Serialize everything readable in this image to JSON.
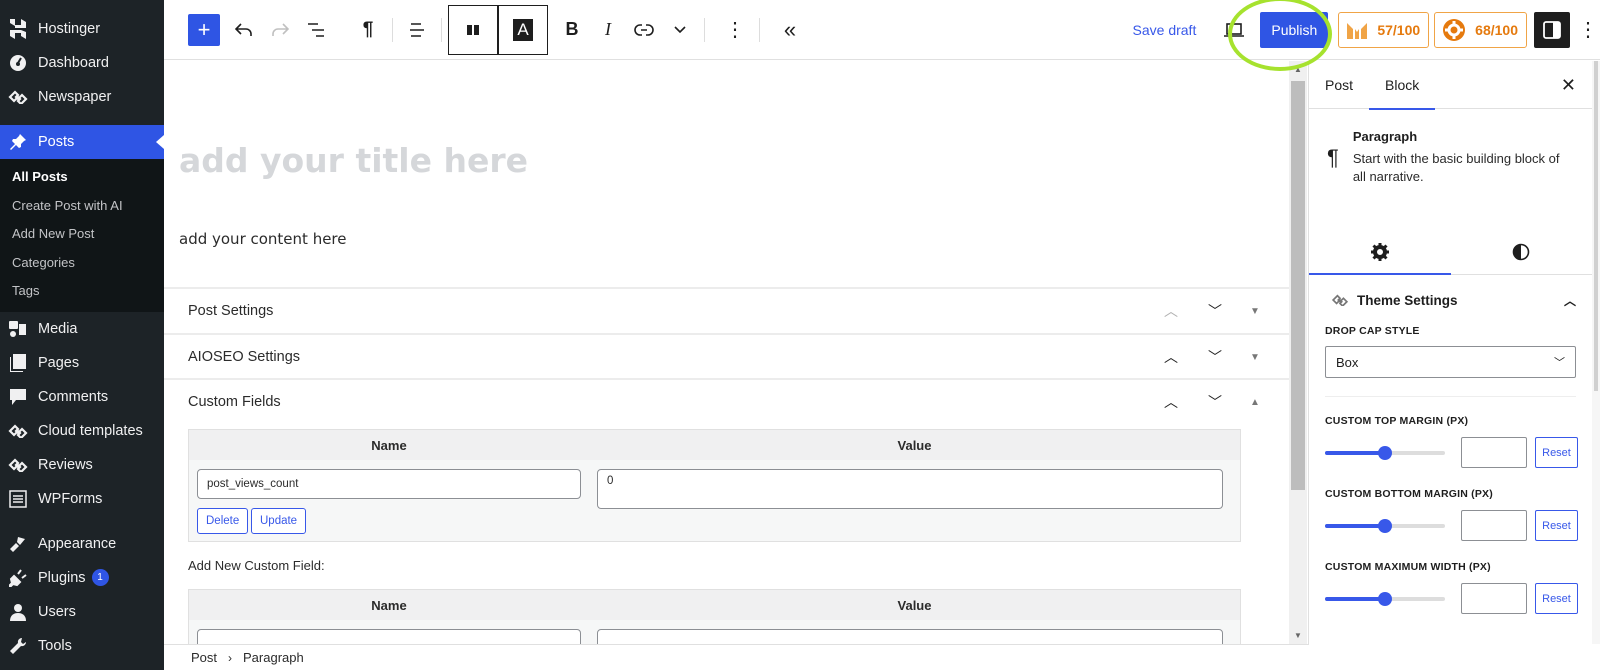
{
  "sidebar": {
    "top_items": [
      {
        "label": "Hostinger",
        "icon": "hostinger-logo-icon"
      },
      {
        "label": "Dashboard",
        "icon": "dashboard-icon"
      },
      {
        "label": "Newspaper",
        "icon": "newspaper-icon"
      }
    ],
    "active_item": {
      "label": "Posts",
      "icon": "pin-icon"
    },
    "submenu": [
      {
        "label": "All Posts",
        "current": true
      },
      {
        "label": "Create Post with AI"
      },
      {
        "label": "Add New Post"
      },
      {
        "label": "Categories"
      },
      {
        "label": "Tags"
      }
    ],
    "items": [
      {
        "label": "Media",
        "icon": "media-icon"
      },
      {
        "label": "Pages",
        "icon": "pages-icon"
      },
      {
        "label": "Comments",
        "icon": "comments-icon"
      },
      {
        "label": "Cloud templates",
        "icon": "cloud-templates-icon"
      },
      {
        "label": "Reviews",
        "icon": "reviews-icon"
      },
      {
        "label": "WPForms",
        "icon": "wpforms-icon"
      }
    ],
    "items2": [
      {
        "label": "Appearance",
        "icon": "appearance-icon"
      },
      {
        "label": "Plugins",
        "icon": "plugins-icon",
        "badge": "1"
      },
      {
        "label": "Users",
        "icon": "users-icon"
      },
      {
        "label": "Tools",
        "icon": "tools-icon"
      }
    ]
  },
  "toolbar": {
    "save_draft": "Save draft",
    "publish": "Publish",
    "score1": "57/100",
    "score2": "68/100",
    "accent": "#2f55e4",
    "score_color": "#e57a0e"
  },
  "editor": {
    "title_placeholder": "add your title here",
    "content_placeholder": "add your content here"
  },
  "meta_boxes": {
    "post_settings": "Post Settings",
    "aioseo": "AIOSEO Settings",
    "custom_fields": "Custom Fields",
    "table_headers": {
      "name": "Name",
      "value": "Value"
    },
    "rows": [
      {
        "name": "post_views_count",
        "value": "0"
      }
    ],
    "delete_label": "Delete",
    "update_label": "Update",
    "add_new_label": "Add New Custom Field:"
  },
  "breadcrumb": [
    "Post",
    "Paragraph"
  ],
  "inspector": {
    "tabs": [
      "Post",
      "Block"
    ],
    "active_tab": "Block",
    "block": {
      "title": "Paragraph",
      "description": "Start with the basic building block of all narrative."
    },
    "theme_settings": "Theme Settings",
    "drop_cap_label": "DROP CAP STYLE",
    "drop_cap_value": "Box",
    "ranges": [
      {
        "label": "CUSTOM TOP MARGIN (PX)",
        "fraction": 0.5,
        "value": ""
      },
      {
        "label": "CUSTOM BOTTOM MARGIN (PX)",
        "fraction": 0.5,
        "value": ""
      },
      {
        "label": "CUSTOM MAXIMUM WIDTH (PX)",
        "fraction": 0.5,
        "value": ""
      }
    ],
    "reset_label": "Reset"
  }
}
